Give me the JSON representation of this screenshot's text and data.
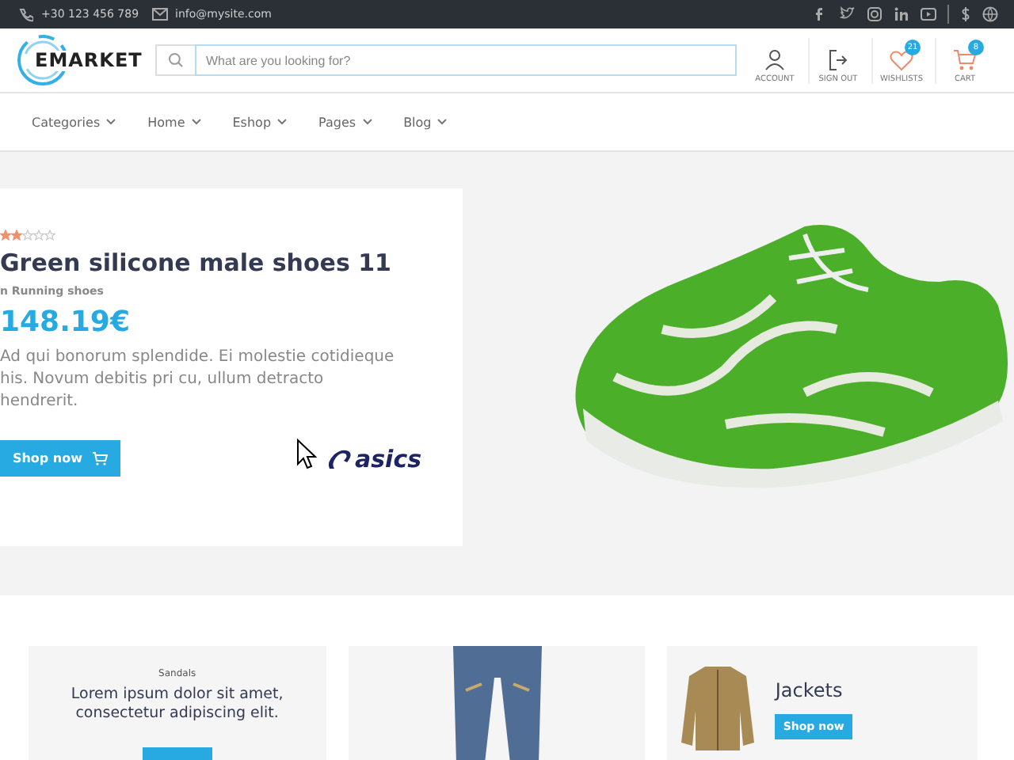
{
  "topbar": {
    "phone": "+30 123 456 789",
    "email": "info@mysite.com"
  },
  "logo": {
    "text": "EMARKET"
  },
  "search": {
    "placeholder": "What are you looking for?"
  },
  "actions": [
    {
      "kind": "account",
      "label": "ACCOUNT"
    },
    {
      "kind": "signout",
      "label": "SIGN OUT"
    },
    {
      "kind": "wishlist",
      "label": "WISHLISTS",
      "badge": "21"
    },
    {
      "kind": "cart",
      "label": "CART",
      "badge": "8"
    }
  ],
  "nav": [
    "Categories",
    "Home",
    "Eshop",
    "Pages",
    "Blog"
  ],
  "hero": {
    "stars": 2,
    "title": "Green silicone male shoes 11",
    "category": "n Running shoes",
    "price": "148.19€",
    "description": "Ad qui bonorum splendide. Ei molestie cotidieque his. Novum debitis pri cu, ullum detracto hendrerit.",
    "button": "Shop now",
    "brand": "asics"
  },
  "promos": [
    {
      "kind": "text",
      "category": "Sandals",
      "text": "Lorem ipsum dolor sit amet, consectetur adipiscing elit."
    },
    {
      "kind": "image"
    },
    {
      "kind": "jacket",
      "title": "Jackets",
      "button": "Shop now"
    }
  ]
}
